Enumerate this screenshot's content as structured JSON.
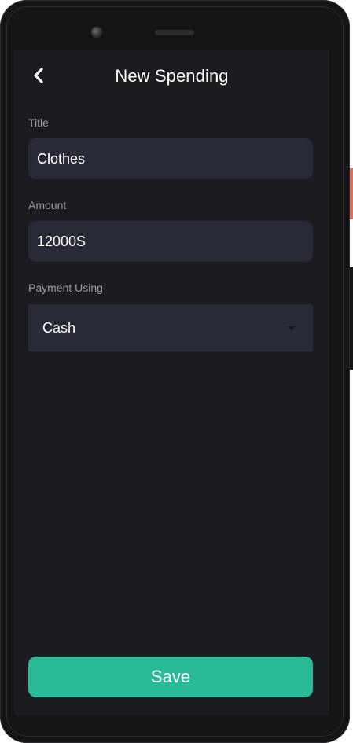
{
  "header": {
    "title": "New Spending",
    "back_icon": "chevron-left-icon"
  },
  "form": {
    "title_field": {
      "label": "Title",
      "value": "Clothes"
    },
    "amount_field": {
      "label": "Amount",
      "value": "12000S"
    },
    "payment_field": {
      "label": "Payment Using",
      "selected": "Cash",
      "caret_icon": "caret-down-icon"
    }
  },
  "actions": {
    "save_label": "Save"
  },
  "colors": {
    "background": "#1b1c20",
    "field": "#282a37",
    "accent": "#29bb98",
    "label": "#9a9ca3"
  }
}
